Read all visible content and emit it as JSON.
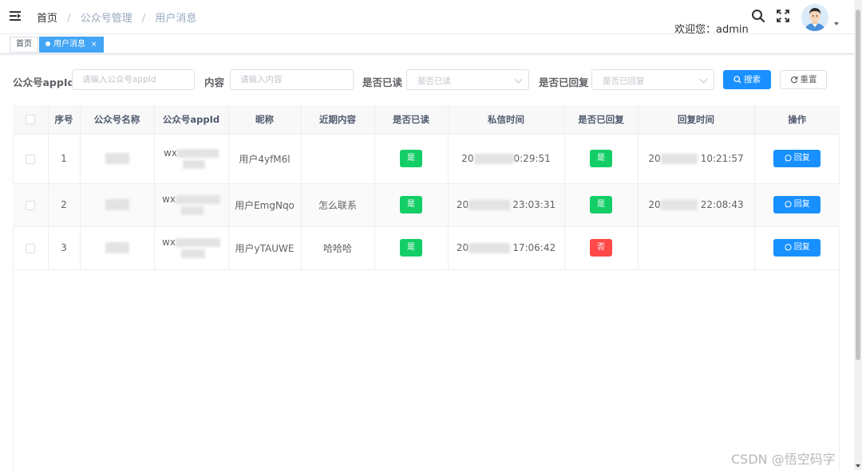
{
  "breadcrumb": [
    "首页",
    "公众号管理",
    "用户消息"
  ],
  "header": {
    "welcome": "欢迎您：admin"
  },
  "tags": [
    {
      "label": "首页",
      "active": false
    },
    {
      "label": "用户消息",
      "active": true,
      "close": "×"
    }
  ],
  "search": {
    "appid_label": "公众号appId",
    "appid_placeholder": "请输入公众号appId",
    "content_label": "内容",
    "content_placeholder": "请输入内容",
    "read_label": "是否已读",
    "read_placeholder": "是否已读",
    "replied_label": "是否已回复",
    "replied_placeholder": "是否已回复",
    "search_button": "搜索",
    "reset_button": "重置"
  },
  "table": {
    "columns": [
      "序号",
      "公众号名称",
      "公众号appId",
      "昵称",
      "近期内容",
      "是否已读",
      "私信时间",
      "是否已回复",
      "回复时间",
      "操作"
    ],
    "rows": [
      {
        "index": "1",
        "appid_prefix": "wx",
        "nickname": "用户4yfM6l",
        "content": "",
        "read": "是",
        "msg_time_prefix": "20",
        "msg_time_suffix": "0:29:51",
        "replied": "是",
        "reply_time_prefix": "20",
        "reply_time_suffix": "10:21:57",
        "action": "回复"
      },
      {
        "index": "2",
        "appid_prefix": "wx",
        "nickname": "用户EmgNqo",
        "content": "怎么联系",
        "read": "是",
        "msg_time_prefix": "20",
        "msg_time_suffix": "23:03:31",
        "replied": "是",
        "reply_time_prefix": "20",
        "reply_time_suffix": "22:08:43",
        "action": "回复"
      },
      {
        "index": "3",
        "appid_prefix": "wx",
        "nickname": "用户yTAUWE",
        "content": "哈哈哈",
        "read": "是",
        "msg_time_prefix": "20",
        "msg_time_suffix": "17:06:42",
        "replied": "否",
        "reply_time_prefix": "",
        "reply_time_suffix": "",
        "action": "回复"
      }
    ]
  },
  "watermark": "CSDN @悟空码字",
  "colors": {
    "primary": "#1890ff",
    "success": "#13ce66",
    "danger": "#ff4949",
    "tag_active": "#42a5f5"
  }
}
